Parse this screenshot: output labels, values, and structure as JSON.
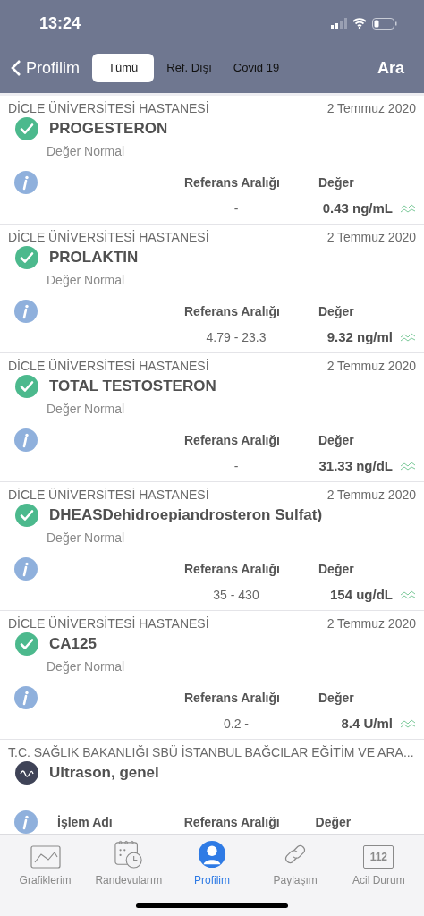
{
  "status_bar": {
    "time": "13:24"
  },
  "nav": {
    "back": "Profilim",
    "action": "Ara",
    "tabs": [
      {
        "label": "Tümü",
        "selected": true
      },
      {
        "label": "Ref. Dışı",
        "selected": false
      },
      {
        "label": "Covid 19",
        "selected": false
      }
    ]
  },
  "results": [
    {
      "kind": "lab",
      "hospital": "DİCLE ÜNİVERSİTESİ HASTANESİ",
      "date": "2 Temmuz 2020",
      "title": "PROGESTERON",
      "status": "Değer Normal",
      "ref_header": "Referans Aralığı",
      "value_header": "Değer",
      "ref": "-",
      "value": "0.43 ng/mL"
    },
    {
      "kind": "lab",
      "hospital": "DİCLE ÜNİVERSİTESİ HASTANESİ",
      "date": "2 Temmuz 2020",
      "title": "PROLAKTIN",
      "status": "Değer Normal",
      "ref_header": "Referans Aralığı",
      "value_header": "Değer",
      "ref": "4.79 - 23.3",
      "value": "9.32 ng/ml"
    },
    {
      "kind": "lab",
      "hospital": "DİCLE ÜNİVERSİTESİ HASTANESİ",
      "date": "2 Temmuz 2020",
      "title": "TOTAL TESTOSTERON",
      "status": "Değer Normal",
      "ref_header": "Referans Aralığı",
      "value_header": "Değer",
      "ref": "-",
      "value": "31.33 ng/dL"
    },
    {
      "kind": "lab",
      "hospital": "DİCLE ÜNİVERSİTESİ HASTANESİ",
      "date": "2 Temmuz 2020",
      "title": "DHEASDehidroepiandrosteron Sulfat)",
      "status": "Değer Normal",
      "ref_header": "Referans Aralığı",
      "value_header": "Değer",
      "ref": "35 - 430",
      "value": "154 ug/dL"
    },
    {
      "kind": "lab",
      "hospital": "DİCLE ÜNİVERSİTESİ HASTANESİ",
      "date": "2 Temmuz 2020",
      "title": "CA125",
      "status": "Değer Normal",
      "ref_header": "Referans Aralığı",
      "value_header": "Değer",
      "ref": "0.2 -",
      "value": "8.4 U/ml"
    },
    {
      "kind": "imaging",
      "hospital": "T.C. SAĞLIK BAKANLIĞI SBÜ İSTANBUL BAĞCILAR EĞİTİM VE ARA...",
      "title": "Ultrason, genel",
      "name_header": "İşlem Adı",
      "ref_header": "Referans Aralığı",
      "value_header": "Değer"
    }
  ],
  "tab_bar": [
    {
      "kind": "chart",
      "label": "Grafiklerim",
      "selected": false
    },
    {
      "kind": "calendar",
      "label": "Randevularım",
      "selected": false
    },
    {
      "kind": "person",
      "label": "Profilim",
      "selected": true
    },
    {
      "kind": "link",
      "label": "Paylaşım",
      "selected": false
    },
    {
      "kind": "emergency",
      "label": "Acil Durum",
      "icon_text": "112",
      "selected": false
    }
  ]
}
